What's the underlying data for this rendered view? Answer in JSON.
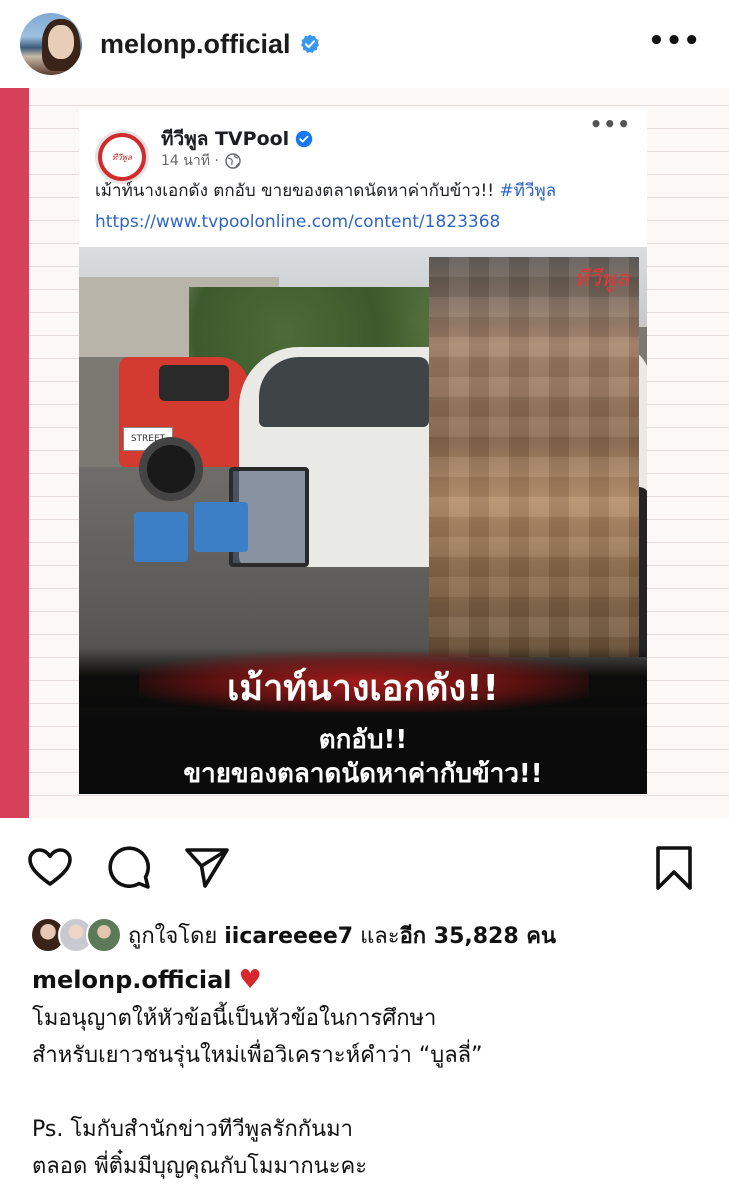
{
  "header": {
    "username": "melonp.official",
    "verified_icon": "verified-badge-icon",
    "more_icon": "more-dots-icon"
  },
  "fb_post": {
    "page_name": "ทีวีพูล TVPool",
    "logo_text": "ทีวีพูล",
    "time": "14 นาที ·",
    "caption_text": "เม้าท์นางเอกดัง ตกอับ ขายของตลาดนัดหาค่ากับข้าว!! ",
    "hashtag": "#ทีวีพูล",
    "link": "https://www.tvpoolonline.com/content/1823368",
    "more": "•••"
  },
  "photo": {
    "watermark": "ทีวีพูล",
    "plate_text": "STREET",
    "headline": "เม้าท์นางเอกดัง!!",
    "sub1": "ตกอับ!!",
    "sub2": "ขายของตลาดนัดหาค่ากับข้าว!!"
  },
  "actions": {
    "like": "heart-icon",
    "comment": "comment-icon",
    "share": "send-icon",
    "save": "bookmark-icon"
  },
  "likes": {
    "prefix": "ถูกใจโดย ",
    "user": "iicareeee7",
    "middle": " และ",
    "count": "อีก 35,828 คน"
  },
  "caption": {
    "user": "melonp.official",
    "emoji": "♥",
    "line1": "โมอนุญาตให้หัวข้อนี้เป็นหัวข้อในการศึกษา",
    "line2": "สำหรับเยาวชนรุ่นใหม่เพื่อวิเคราะห์คำว่า “บูลลี่”",
    "line3": "Ps. โมกับสำนักข่าวทีวีพูลรักกันมา",
    "line4": "ตลอด พี่ติ๋มมีบุญคุณกับโมมากนะคะ"
  }
}
